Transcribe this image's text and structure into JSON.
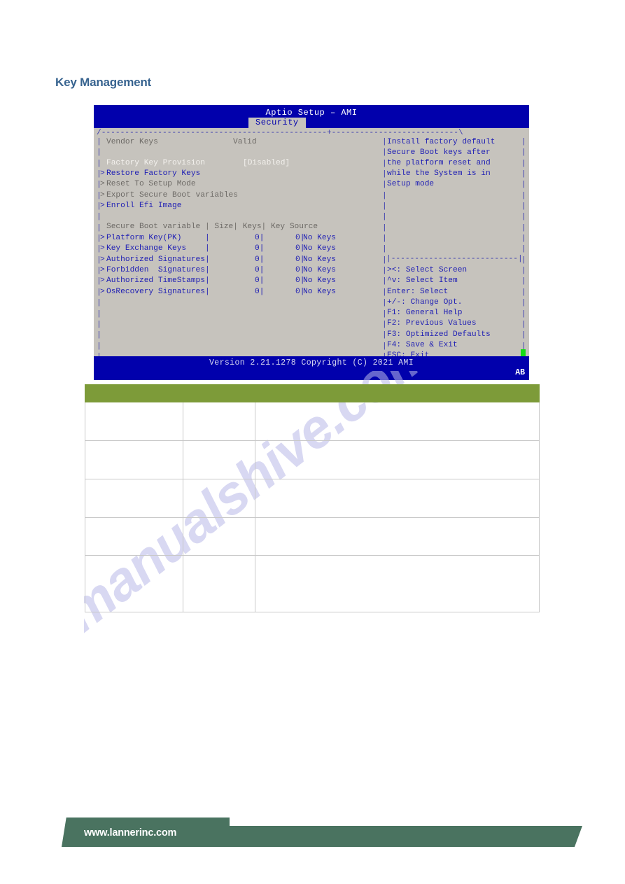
{
  "page": {
    "title": "Key Management"
  },
  "bios": {
    "title": "Aptio Setup – AMI",
    "tab": "Security",
    "version": "Version 2.21.1278 Copyright (C) 2021 AMI",
    "corner_label": "AB",
    "frame_top": "/------------------------------------------------+---------------------------\\",
    "frame_bottom": "\\------------------------------------------------+---------------------------/",
    "right_divider": "|---------------------------|",
    "status": {
      "vendor_keys_label": "Vendor Keys",
      "vendor_keys_value": "Valid",
      "factory_key_provision_label": "Factory Key Provision",
      "factory_key_provision_value": "[Disabled]"
    },
    "actions": [
      {
        "label": "Restore Factory Keys",
        "marker": "> ",
        "style": "blue"
      },
      {
        "label": "Reset To Setup Mode",
        "marker": "> ",
        "style": "gray"
      },
      {
        "label": "Export Secure Boot variables",
        "marker": "> ",
        "style": "gray"
      },
      {
        "label": "Enroll Efi Image",
        "marker": "> ",
        "style": "blue"
      }
    ],
    "table": {
      "header": "Secure Boot variable | Size| Keys| Key Source",
      "columns": [
        "Secure Boot variable",
        "Size",
        "Keys",
        "Key Source"
      ],
      "rows": [
        {
          "name": "Platform Key(PK)",
          "padded": "Platform Key(PK)     |",
          "size": "0|",
          "keys": "0|",
          "source": "No Keys"
        },
        {
          "name": "Key Exchange Keys",
          "padded": "Key Exchange Keys    |",
          "size": "0|",
          "keys": "0|",
          "source": "No Keys"
        },
        {
          "name": "Authorized Signatures",
          "padded": "Authorized Signatures|",
          "size": "0|",
          "keys": "0|",
          "source": "No Keys"
        },
        {
          "name": "Forbidden  Signatures",
          "padded": "Forbidden  Signatures|",
          "size": "0|",
          "keys": "0|",
          "source": "No Keys"
        },
        {
          "name": "Authorized TimeStamps",
          "padded": "Authorized TimeStamps|",
          "size": "0|",
          "keys": "0|",
          "source": "No Keys"
        },
        {
          "name": "OsRecovery Signatures",
          "padded": "OsRecovery Signatures|",
          "size": "0|",
          "keys": "0|",
          "source": "No Keys"
        }
      ]
    },
    "help": [
      "Install factory default",
      "Secure Boot keys after",
      "the platform reset and",
      "while the System is in",
      "Setup mode"
    ],
    "keys": [
      "><: Select Screen",
      "^v: Select Item",
      "Enter: Select",
      "+/-: Change Opt.",
      "F1: General Help",
      "F2: Previous Values",
      "F3: Optimized Defaults",
      "F4: Save & Exit",
      "ESC: Exit"
    ],
    "colors": {
      "background": "#c6c3bd",
      "title_bar": "#0100ac",
      "accent_blue": "#1f1fb4",
      "scrollbar": "#14dd14"
    }
  },
  "doc_table": {
    "header_color": "#7d9b39",
    "columns": [
      "",
      "",
      ""
    ],
    "rows": [
      {
        "cells": [
          "",
          "",
          ""
        ]
      },
      {
        "cells": [
          "",
          "",
          ""
        ]
      },
      {
        "cells": [
          "",
          "",
          ""
        ]
      },
      {
        "cells": [
          "",
          "",
          ""
        ]
      },
      {
        "cells": [
          "",
          "",
          ""
        ]
      }
    ]
  },
  "watermark": {
    "text": "manualshive.com"
  },
  "footer": {
    "url": "www.lannerinc.com",
    "color": "#4a7360"
  }
}
